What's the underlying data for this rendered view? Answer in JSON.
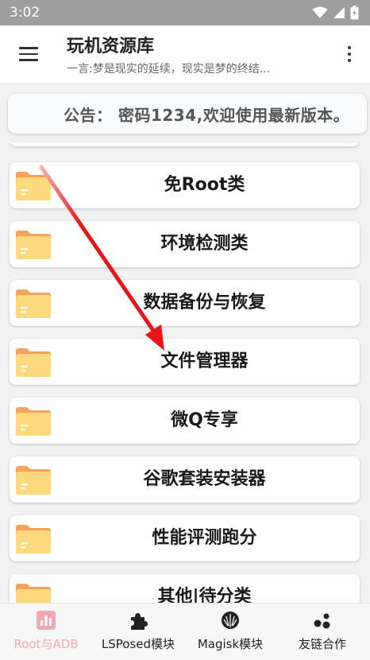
{
  "status_bar": {
    "time": "3:02"
  },
  "app_bar": {
    "title": "玩机资源库",
    "subtitle": "一言:梦是现实的延续，现实是梦的终结..."
  },
  "notice": {
    "text": "公告： 密码1234,欢迎使用最新版本。"
  },
  "categories": [
    {
      "label": "免Root类"
    },
    {
      "label": "环境检测类"
    },
    {
      "label": "数据备份与恢复"
    },
    {
      "label": "文件管理器"
    },
    {
      "label": "微Q专享"
    },
    {
      "label": "谷歌套装安装器"
    },
    {
      "label": "性能评测跑分"
    },
    {
      "label": "其他|待分类"
    }
  ],
  "bottom_nav": [
    {
      "label": "Root与ADB",
      "icon": "bar-chart-icon",
      "active": true
    },
    {
      "label": "LSPosed模块",
      "icon": "puzzle-icon",
      "active": false
    },
    {
      "label": "Magisk模块",
      "icon": "magisk-icon",
      "active": false
    },
    {
      "label": "友链合作",
      "icon": "dots-cluster-icon",
      "active": false
    }
  ],
  "colors": {
    "status_bar": "#9e9e9e",
    "folder_body": "#fcd97a",
    "folder_tab": "#f6a25a",
    "nav_active": "#f2a8b0",
    "arrow": "#e8141a"
  }
}
